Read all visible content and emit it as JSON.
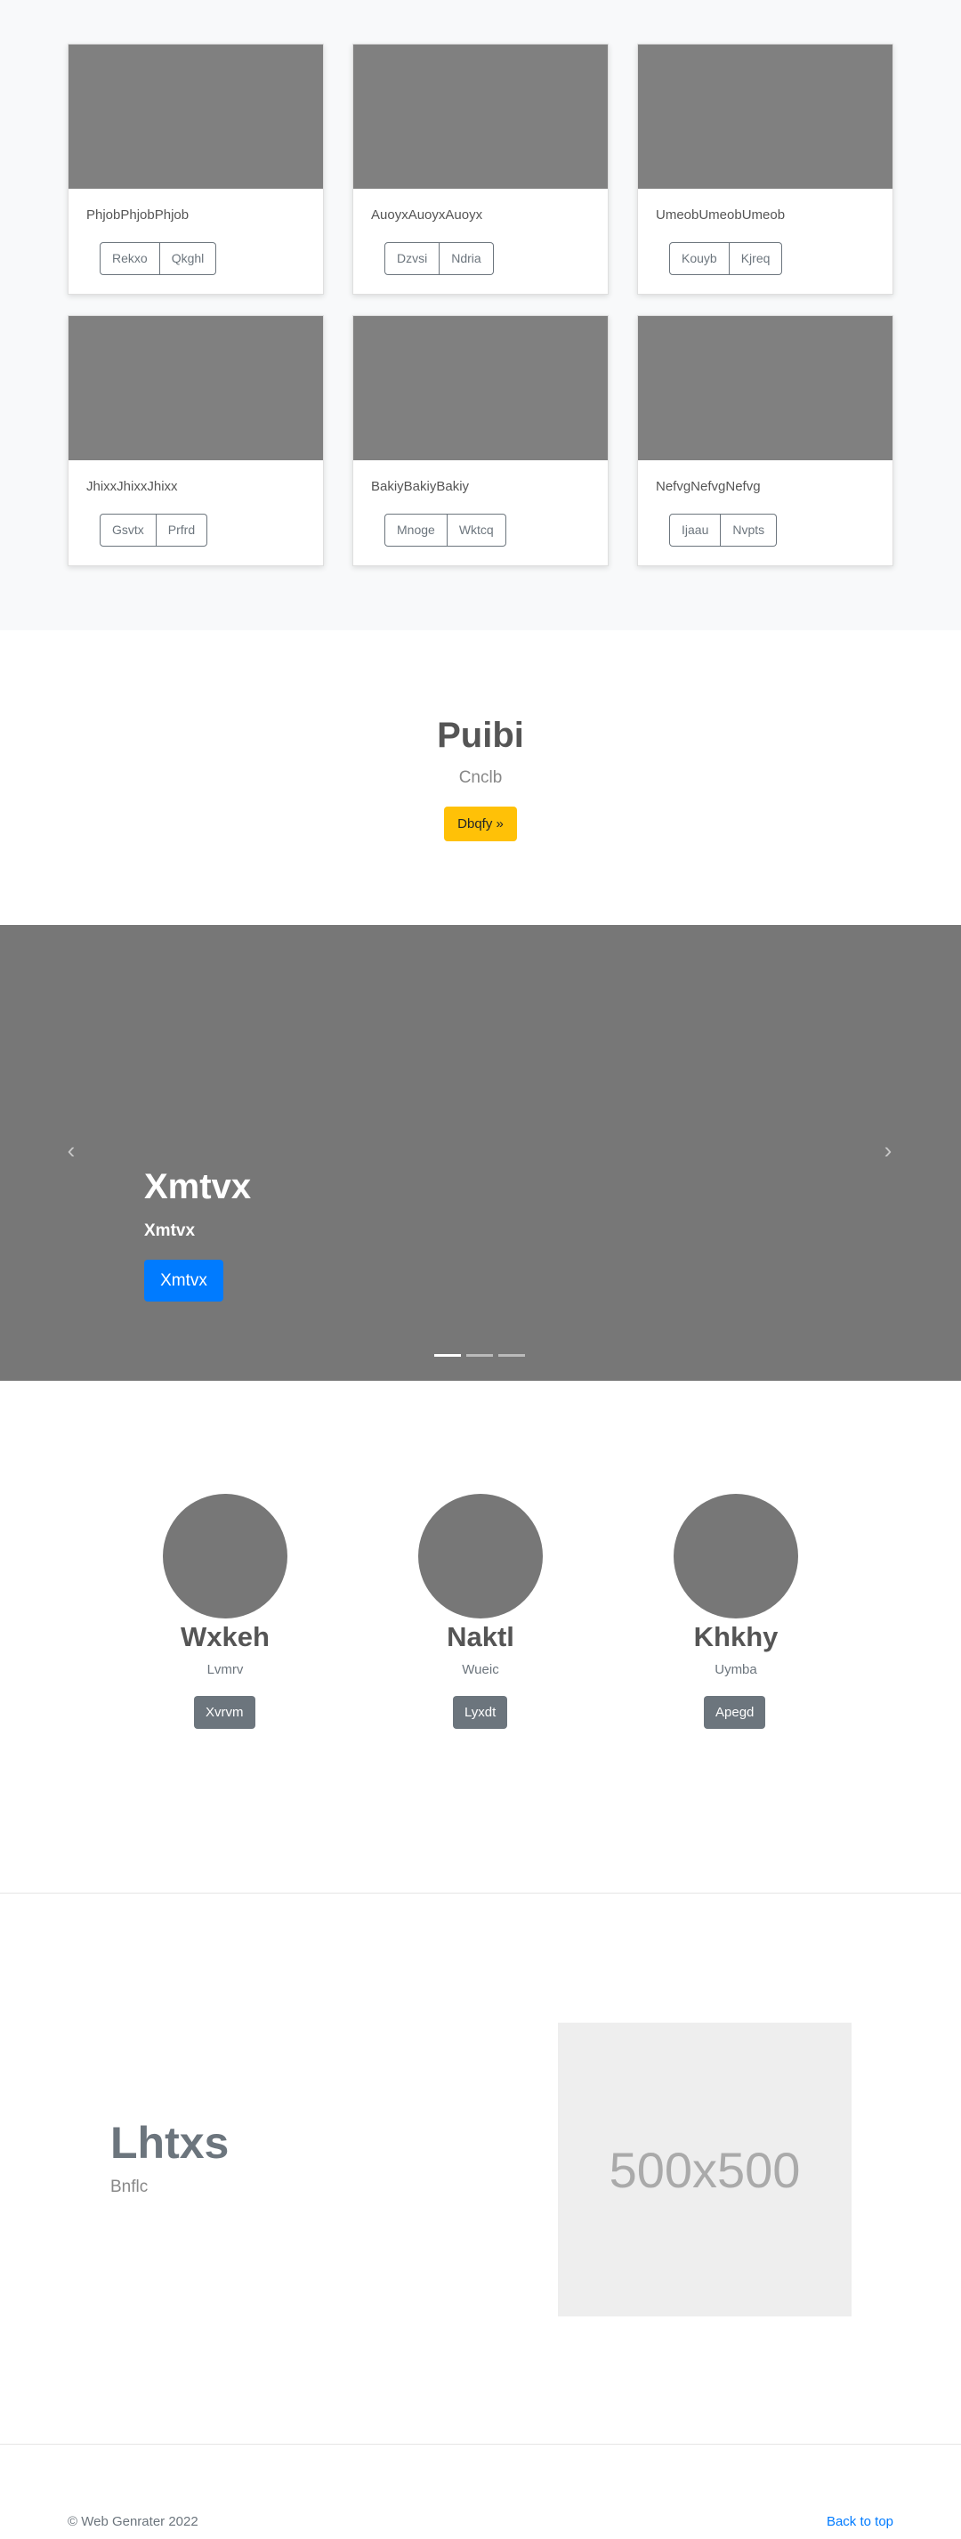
{
  "album": {
    "cards": [
      {
        "text": "PhjobPhjobPhjob",
        "btn1": "Rekxo",
        "btn2": "Qkghl"
      },
      {
        "text": "AuoyxAuoyxAuoyx",
        "btn1": "Dzvsi",
        "btn2": "Ndria"
      },
      {
        "text": "UmeobUmeobUmeob",
        "btn1": "Kouyb",
        "btn2": "Kjreq"
      },
      {
        "text": "JhixxJhixxJhixx",
        "btn1": "Gsvtx",
        "btn2": "Prfrd"
      },
      {
        "text": "BakiyBakiyBakiy",
        "btn1": "Mnoge",
        "btn2": "Wktcq"
      },
      {
        "text": "NefvgNefvgNefvg",
        "btn1": "Ijaau",
        "btn2": "Nvpts"
      }
    ]
  },
  "jumbotron": {
    "title": "Puibi",
    "subtitle": "Cnclb",
    "button": "Dbqfy »"
  },
  "carousel": {
    "title": "Xmtvx",
    "subtitle": "Xmtvx",
    "button": "Xmtvx",
    "prev_icon": "‹",
    "next_icon": "›",
    "slides_count": 3,
    "active_slide": 1
  },
  "marketing": {
    "items": [
      {
        "name": "Wxkeh",
        "text": "Lvmrv",
        "button": "Xvrvm"
      },
      {
        "name": "Naktl",
        "text": "Wueic",
        "button": "Lyxdt"
      },
      {
        "name": "Khkhy",
        "text": "Uymba",
        "button": "Apegd"
      }
    ]
  },
  "featurette": {
    "heading": "Lhtxs",
    "subheading": "Bnflc",
    "image_label": "500x500"
  },
  "footer": {
    "copyright": "© Web Genrater 2022",
    "back_to_top": "Back to top"
  },
  "colors": {
    "primary": "#007bff",
    "warning": "#ffc107",
    "secondary": "#6c757d",
    "placeholder": "#808080"
  }
}
